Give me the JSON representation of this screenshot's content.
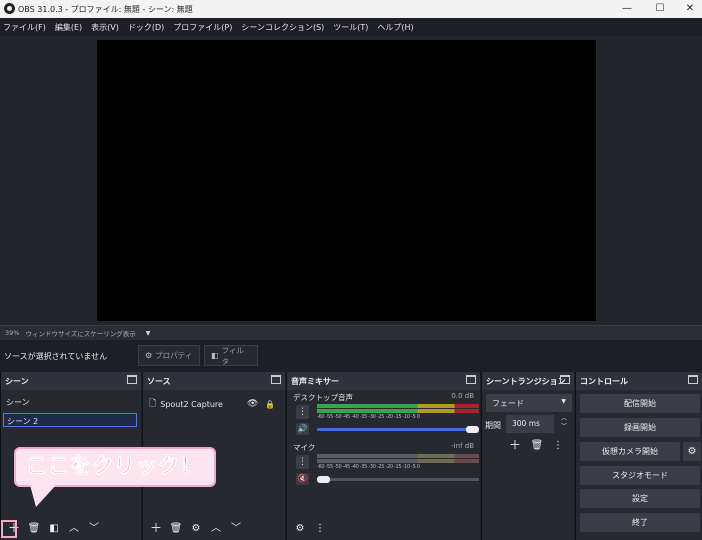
{
  "window": {
    "title": "OBS 31.0.3 - プロファイル: 無題 - シーン: 無題",
    "minimize": "—",
    "maximize": "☐",
    "close": "✕"
  },
  "menu": [
    "ファイル(F)",
    "編集(E)",
    "表示(V)",
    "ドック(D)",
    "プロファイル(P)",
    "シーンコレクション(S)",
    "ツール(T)",
    "ヘルプ(H)"
  ],
  "status": {
    "zoom": "39%",
    "scaling": "ウィンドウサイズにスケーリング表示",
    "caret": "▼"
  },
  "source_bar": {
    "message": "ソースが選択されていません",
    "properties": "プロパティ",
    "filters": "フィルタ"
  },
  "scenes": {
    "title": "シーン",
    "items": [
      "シーン",
      "シーン 2"
    ],
    "selected": "シーン 2"
  },
  "sources": {
    "title": "ソース",
    "items": [
      {
        "name": "Spout2 Capture"
      }
    ]
  },
  "mixer": {
    "title": "音声ミキサー",
    "scale_labels": "-60 -55 -50 -45 -40 -35 -30 -25 -20 -15 -10 -5 0",
    "tracks": [
      {
        "name": "デスクトップ音声",
        "db": "0.0 dB",
        "volume": 1.0,
        "muted": false
      },
      {
        "name": "マイク",
        "db": "-inf dB",
        "volume": 0.0,
        "muted": true
      }
    ]
  },
  "transitions": {
    "title": "シーントランジション",
    "selected": "フェード",
    "duration_label": "期間",
    "duration": "300 ms"
  },
  "controls": {
    "title": "コントロール",
    "buttons": [
      "配信開始",
      "録画開始",
      "仮想カメラ開始",
      "スタジオモード",
      "設定",
      "終了"
    ]
  },
  "callout": {
    "text": "ここをクリック！"
  },
  "colors": {
    "accent": "#3c6fe0",
    "callout_fill": "#fde4ee",
    "callout_text": "#f04a8c",
    "callout_border": "#f5a9c5",
    "meter_green": "#2fa84f",
    "meter_yellow": "#b49a22",
    "meter_red": "#a8242c"
  }
}
